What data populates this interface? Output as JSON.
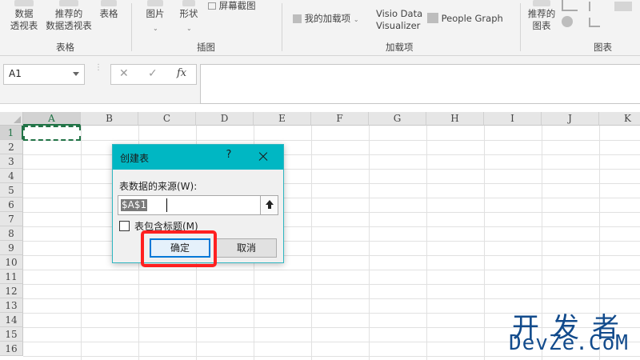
{
  "ribbon": {
    "groups": [
      {
        "label": "表格",
        "buttons": [
          {
            "label": "数据\n透视表"
          },
          {
            "label": "推荐的\n数据透视表"
          },
          {
            "label": "表格"
          }
        ]
      },
      {
        "label": "插图",
        "buttons": [
          {
            "label": "图片"
          },
          {
            "label": "形状"
          },
          {
            "label": "屏幕截图"
          }
        ]
      },
      {
        "label": "加载项",
        "buttons": [
          {
            "label": "我的加载项"
          },
          {
            "label": "Visio Data\nVisualizer"
          },
          {
            "label": "People Graph"
          }
        ]
      },
      {
        "label": "图表",
        "buttons": [
          {
            "label": "推荐的\n图表"
          }
        ]
      }
    ]
  },
  "formula_bar": {
    "name_box": "A1",
    "cancel_glyph": "✕",
    "enter_glyph": "✓",
    "fx_label": "fx",
    "formula": ""
  },
  "sheet": {
    "columns": [
      "A",
      "B",
      "C",
      "D",
      "E",
      "F",
      "G",
      "H",
      "I",
      "J",
      "K"
    ],
    "rows": [
      "1",
      "2",
      "3",
      "4",
      "5",
      "6",
      "7",
      "8",
      "9",
      "10",
      "11",
      "12",
      "13",
      "14",
      "15",
      "16"
    ],
    "selected_cell": "A1"
  },
  "dialog": {
    "title": "创建表",
    "help": "?",
    "source_label": "表数据的来源(W):",
    "source_value": "$A$1",
    "has_headers_label": "表包含标题(M)",
    "has_headers_checked": false,
    "ok_label": "确定",
    "cancel_label": "取消"
  },
  "watermark": {
    "cn": "开发者",
    "en": "DevZe.CoM"
  },
  "colors": {
    "dialog_title": "#00b7c3",
    "excel_green": "#217346",
    "highlight": "#ff2020",
    "watermark": "#124b8c"
  }
}
